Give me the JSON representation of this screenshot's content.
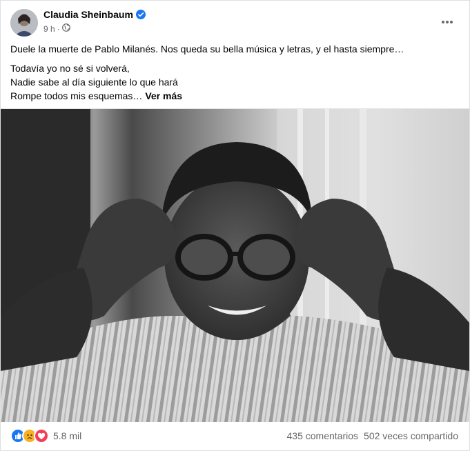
{
  "post": {
    "author": "Claudia Sheinbaum",
    "time": "9 h",
    "separator": "·",
    "more_icon": "more-horizontal-icon",
    "text_first": "Duele la muerte de Pablo Milanés. Nos queda su bella música y letras, y el hasta siempre…",
    "lines": [
      "Todavía yo no sé si volverá,",
      "Nadie sabe al día siguiente lo que hará",
      "Rompe todos mis esquemas…"
    ],
    "see_more": "Ver más"
  },
  "footer": {
    "reaction_count": "5.8 mil",
    "comments": "435 comentarios",
    "shares": "502 veces compartido"
  },
  "colors": {
    "like": "#1877f2",
    "sad": "#f7b125",
    "love": "#f33e58",
    "verified": "#1877f2",
    "secondary_text": "#65676b"
  }
}
